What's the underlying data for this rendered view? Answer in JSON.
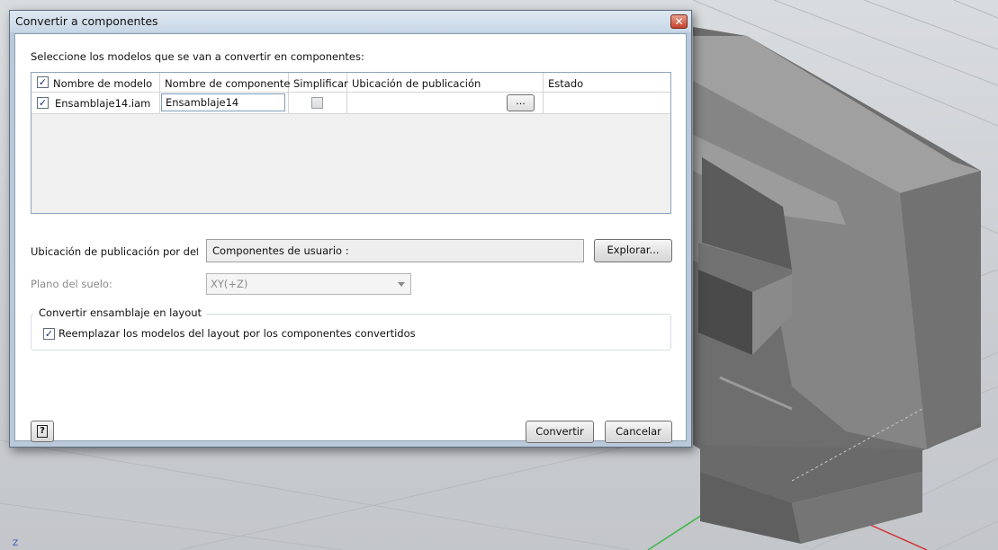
{
  "dialog": {
    "title": "Convertir a componentes",
    "close_label": "✕",
    "instruction": "Seleccione los modelos que se van a convertir en componentes:",
    "table": {
      "headers": {
        "model_name": "Nombre de modelo",
        "component_name": "Nombre de componente",
        "simplify": "Simplificar",
        "publish_location": "Ubicación de publicación",
        "status": "Estado"
      },
      "header_checked": true,
      "rows": [
        {
          "checked": true,
          "model_name": "Ensamblaje14.iam",
          "component_name": "Ensamblaje14",
          "simplify": false,
          "publish_location": "",
          "browse_label": "...",
          "status": ""
        }
      ]
    },
    "default_location_label": "Ubicación de publicación por defecto",
    "default_location_value": "Componentes de usuario :",
    "browse_button": "Explorar...",
    "floor_plane_label": "Plano del suelo:",
    "floor_plane_value": "XY(+Z)",
    "group_title": "Convertir ensamblaje en layout",
    "replace_checkbox_label": "Reemplazar los modelos del layout por los componentes convertidos",
    "replace_checked": true,
    "help_label": "?",
    "convert_button": "Convertir",
    "cancel_button": "Cancelar"
  },
  "viewport": {
    "axis_label": "Z"
  },
  "colors": {
    "title_bar": "#c7d6e6",
    "window_frame": "#b9c9da",
    "model_gray": "#7d7d7d",
    "viewport_bg": "#cfd2d5"
  }
}
